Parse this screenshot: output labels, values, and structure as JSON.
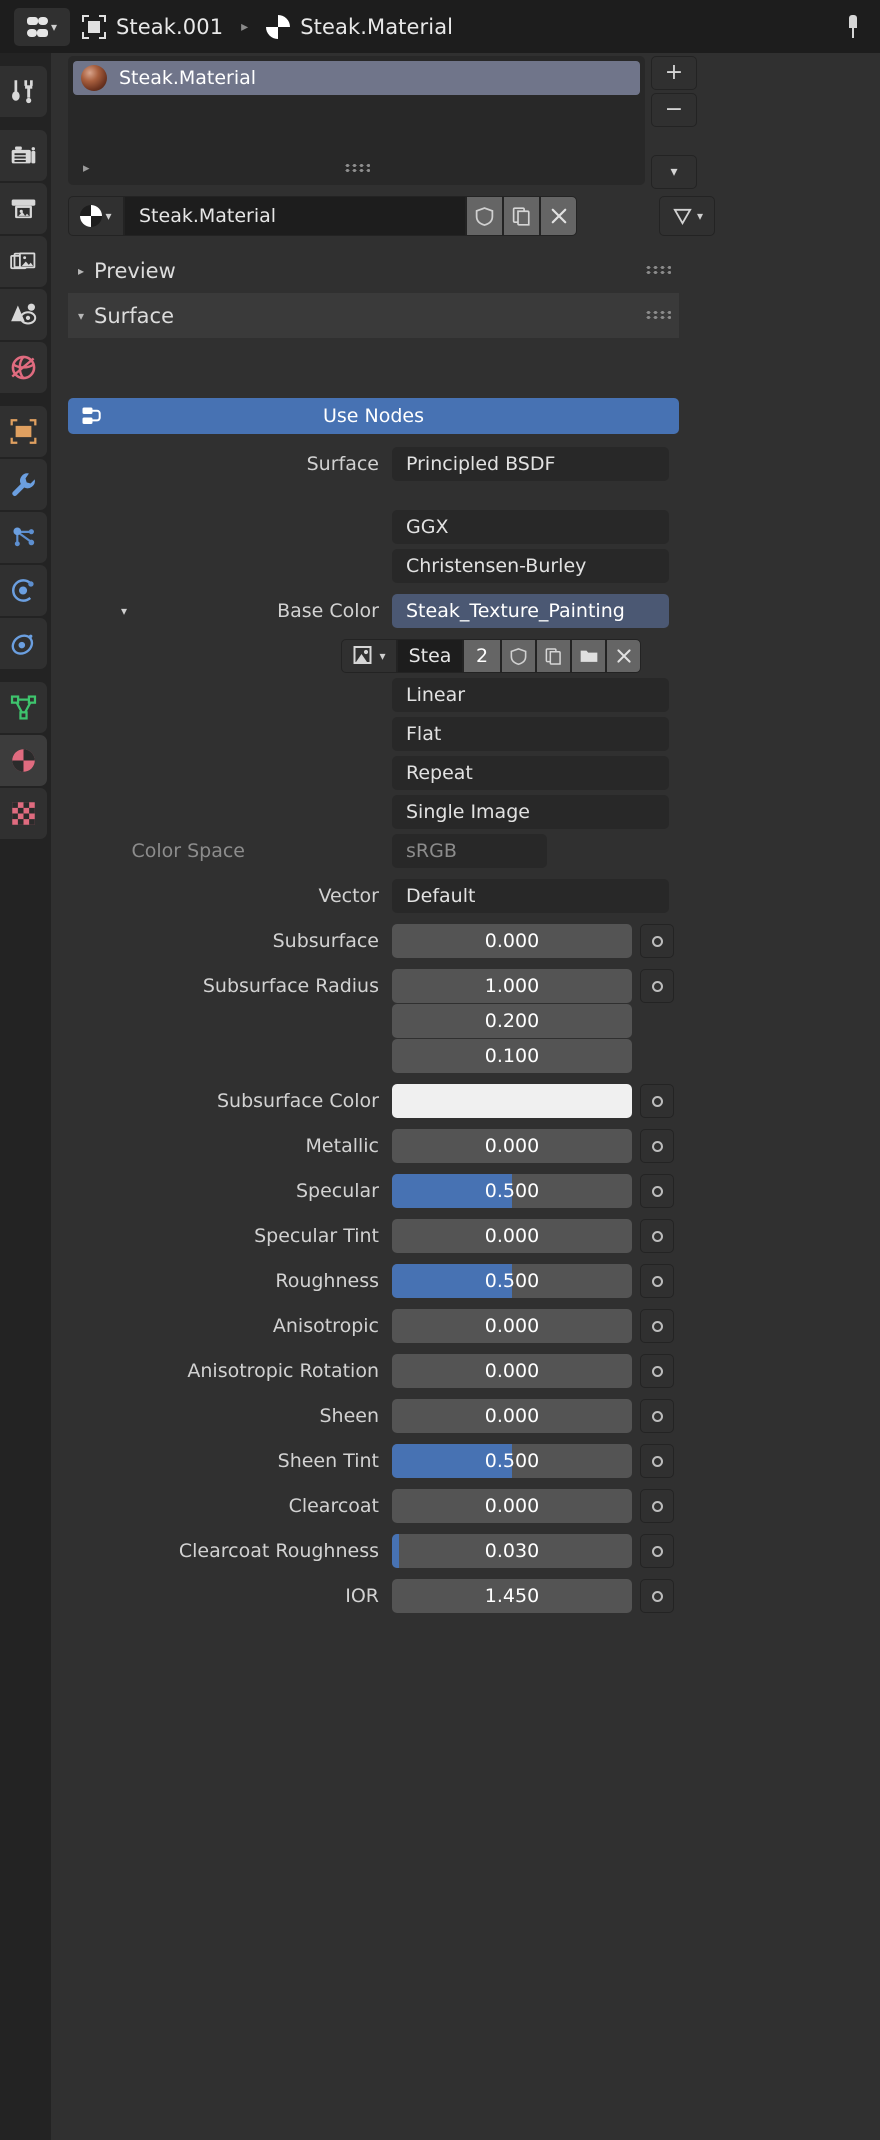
{
  "header": {
    "editor_type_icon": "editor-type-icon",
    "breadcrumb": [
      {
        "icon": "object-icon",
        "label": "Steak.001"
      },
      {
        "icon": "material-icon",
        "label": "Steak.Material"
      }
    ],
    "pin_icon": "pin-icon"
  },
  "rail": {
    "tabs": [
      {
        "name": "tool",
        "icon": "tool-icon",
        "color": "#d8d8d8",
        "active": false
      },
      {
        "name": "render",
        "icon": "camera-icon",
        "color": "#d8d8d8",
        "active": false
      },
      {
        "name": "output",
        "icon": "printer-icon",
        "color": "#d8d8d8",
        "active": false
      },
      {
        "name": "view-layer",
        "icon": "images-icon",
        "color": "#d8d8d8",
        "active": false
      },
      {
        "name": "scene",
        "icon": "scene-icon",
        "color": "#d8d8d8",
        "active": false
      },
      {
        "name": "world",
        "icon": "world-icon",
        "color": "#e06b7f",
        "active": false
      },
      {
        "name": "object",
        "icon": "object-square-icon",
        "color": "#e0a060",
        "active": false
      },
      {
        "name": "modifiers",
        "icon": "wrench-icon",
        "color": "#6b9fe0",
        "active": false
      },
      {
        "name": "particles",
        "icon": "particles-icon",
        "color": "#6b9fe0",
        "active": false
      },
      {
        "name": "physics",
        "icon": "physics-icon",
        "color": "#6b9fe0",
        "active": false
      },
      {
        "name": "constraints",
        "icon": "constraint-icon",
        "color": "#6b9fe0",
        "active": false
      },
      {
        "name": "object-data",
        "icon": "mesh-data-icon",
        "color": "#3ec46d",
        "active": false
      },
      {
        "name": "material",
        "icon": "material-ball-icon",
        "color": "#e06b7f",
        "active": true
      },
      {
        "name": "texture",
        "icon": "checker-icon",
        "color": "#e06b7f",
        "active": false
      }
    ]
  },
  "slots": {
    "items": [
      {
        "name": "Steak.Material",
        "thumb": "material-preview-thumb"
      }
    ],
    "add_label": "+",
    "remove_label": "−",
    "menu_icon": "chevron-down-icon",
    "expand_icon": "triangle-right-icon",
    "grip_icon": "drag-grip-icon"
  },
  "datablock": {
    "browse_icon": "material-browse-icon",
    "name": "Steak.Material",
    "fake_user_icon": "shield-icon",
    "new_copy_icon": "copy-icon",
    "unlink_icon": "close-icon",
    "display_filter_icon": "mesh-filter-icon"
  },
  "sections": {
    "preview": {
      "label": "Preview",
      "arrow": "▶",
      "expanded": false
    },
    "surface": {
      "label": "Surface",
      "arrow": "▼",
      "expanded": true
    }
  },
  "use_nodes": {
    "label": "Use Nodes",
    "icon": "nodetree-icon",
    "color": "#4772b3"
  },
  "surface": {
    "surface_label": "Surface",
    "surface_value": "Principled BSDF",
    "distribution": "GGX",
    "subsurface_method": "Christensen-Burley",
    "base_color_label": "Base Color",
    "base_color_value": "Steak_Texture_Painting",
    "texture": {
      "browse_icon": "image-browse-icon",
      "name": "Stea",
      "users": "2",
      "fake_user_icon": "shield-icon",
      "new_copy_icon": "copy-icon",
      "open_icon": "folder-icon",
      "unlink_icon": "close-icon"
    },
    "interpolation": "Linear",
    "projection": "Flat",
    "extension": "Repeat",
    "source": "Single Image",
    "color_space_label": "Color Space",
    "color_space_value": "sRGB"
  },
  "properties": [
    {
      "label": "Vector",
      "type": "node",
      "value": "Default",
      "socket": true
    },
    {
      "label": "Subsurface",
      "type": "slider",
      "value": "0.000",
      "fill": 0,
      "socket": true
    },
    {
      "label": "Subsurface Radius",
      "type": "vector",
      "values": [
        "1.000",
        "0.200",
        "0.100"
      ],
      "socket": true
    },
    {
      "label": "Subsurface Color",
      "type": "color",
      "color": "#f0f0f0",
      "socket": true
    },
    {
      "label": "Metallic",
      "type": "slider",
      "value": "0.000",
      "fill": 0,
      "socket": true
    },
    {
      "label": "Specular",
      "type": "slider",
      "value": "0.500",
      "fill": 50,
      "socket": true
    },
    {
      "label": "Specular Tint",
      "type": "slider",
      "value": "0.000",
      "fill": 0,
      "socket": true
    },
    {
      "label": "Roughness",
      "type": "slider",
      "value": "0.500",
      "fill": 50,
      "socket": true
    },
    {
      "label": "Anisotropic",
      "type": "slider",
      "value": "0.000",
      "fill": 0,
      "socket": true
    },
    {
      "label": "Anisotropic Rotation",
      "type": "slider",
      "value": "0.000",
      "fill": 0,
      "socket": true
    },
    {
      "label": "Sheen",
      "type": "slider",
      "value": "0.000",
      "fill": 0,
      "socket": true
    },
    {
      "label": "Sheen Tint",
      "type": "slider",
      "value": "0.500",
      "fill": 50,
      "socket": true
    },
    {
      "label": "Clearcoat",
      "type": "slider",
      "value": "0.000",
      "fill": 0,
      "socket": true
    },
    {
      "label": "Clearcoat Roughness",
      "type": "slider",
      "value": "0.030",
      "fill": 3,
      "socket": true
    },
    {
      "label": "IOR",
      "type": "slider",
      "value": "1.450",
      "fill": 0,
      "socket": true
    }
  ],
  "colors": {
    "accent_blue": "#4772b3",
    "panel_bg": "#303030",
    "header_bg": "#1d1d1d",
    "field_bg": "#282828",
    "slider_bg": "#545454",
    "selected_row": "#70758a",
    "linked_socket": "#4b5873"
  }
}
